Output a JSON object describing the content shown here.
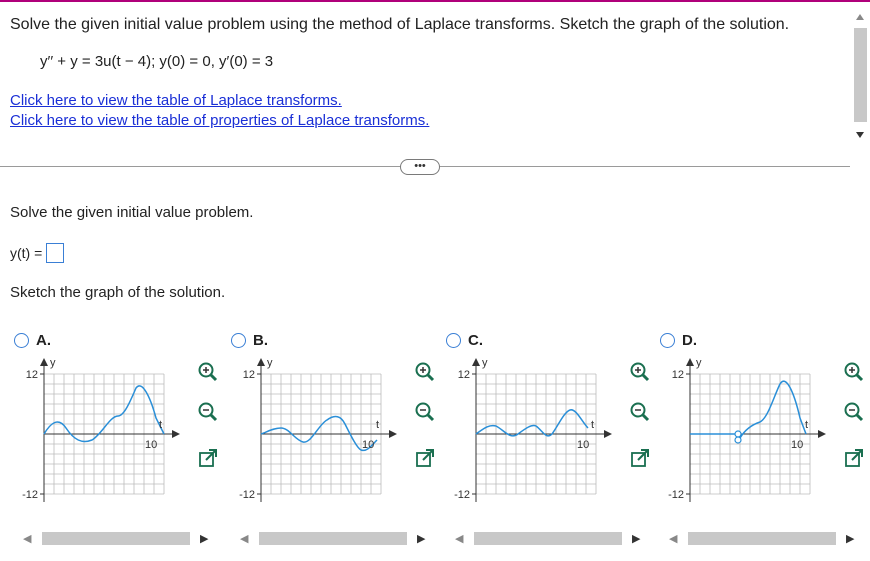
{
  "question": "Solve the given initial value problem using the method of Laplace transforms. Sketch the graph of the solution.",
  "equation": "y′′ + y = 3u(t − 4);   y(0) = 0,   y′(0) = 3",
  "links": {
    "table": "Click here to view the table of Laplace transforms.",
    "properties": "Click here to view the table of properties of Laplace transforms."
  },
  "more_button": "•••",
  "prompt": "Solve the given initial value problem.",
  "answer_label": "y(t) =",
  "sketch_prompt": "Sketch the graph of the solution.",
  "options": [
    {
      "label": "A.",
      "y_top": "12",
      "y_bottom": "-12",
      "x_tick": "10",
      "x_label": "t",
      "y_label": "y"
    },
    {
      "label": "B.",
      "y_top": "12",
      "y_bottom": "-12",
      "x_tick": "10",
      "x_label": "t",
      "y_label": "y"
    },
    {
      "label": "C.",
      "y_top": "12",
      "y_bottom": "-12",
      "x_tick": "10",
      "x_label": "t",
      "y_label": "y"
    },
    {
      "label": "D.",
      "y_top": "12",
      "y_bottom": "-12",
      "x_tick": "10",
      "x_label": "t",
      "y_label": "y"
    }
  ],
  "colors": {
    "accent": "#1a2fd6",
    "curve": "#2a8fd8",
    "radio": "#3a7fd5",
    "topbar": "#b0007a"
  }
}
